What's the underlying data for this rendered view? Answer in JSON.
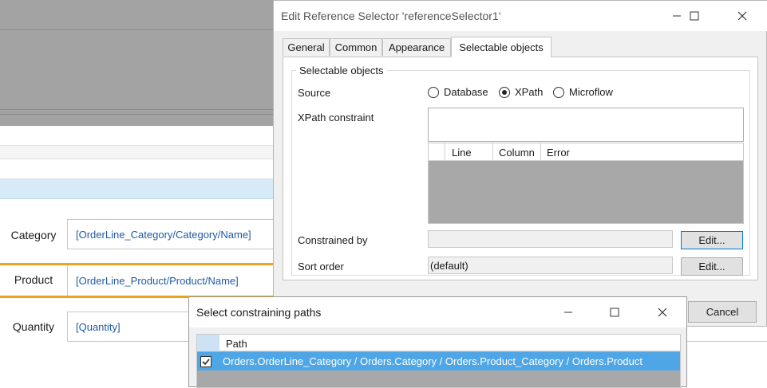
{
  "background": {
    "fields": [
      {
        "label": "Category",
        "value": "[OrderLine_Category/Category/Name]"
      },
      {
        "label": "Product",
        "value": "[OrderLine_Product/Product/Name]"
      },
      {
        "label": "Quantity",
        "value": "[Quantity]"
      }
    ],
    "accent_color": "#f0a21c",
    "highlight_color": "#d6eaf8"
  },
  "dialog": {
    "title": "Edit Reference Selector 'referenceSelector1'",
    "tabs": [
      "General",
      "Common",
      "Appearance",
      "Selectable objects"
    ],
    "active_tab": "Selectable objects",
    "group_title": "Selectable objects",
    "source_label": "Source",
    "source_options": [
      "Database",
      "XPath",
      "Microflow"
    ],
    "source_selected": "XPath",
    "xpath_label": "XPath constraint",
    "xpath_value": "",
    "error_columns": [
      "Line",
      "Column",
      "Error"
    ],
    "constrained_by_label": "Constrained by",
    "constrained_by_value": "",
    "sort_order_label": "Sort order",
    "sort_order_value": "(default)",
    "edit_label": "Edit...",
    "cancel_label": "Cancel"
  },
  "constraining_dialog": {
    "title": "Select constraining paths",
    "column_header": "Path",
    "rows": [
      {
        "checked": true,
        "path": "Orders.OrderLine_Category / Orders.Category / Orders.Product_Category / Orders.Product"
      }
    ],
    "selection_color": "#4ea6e6"
  }
}
